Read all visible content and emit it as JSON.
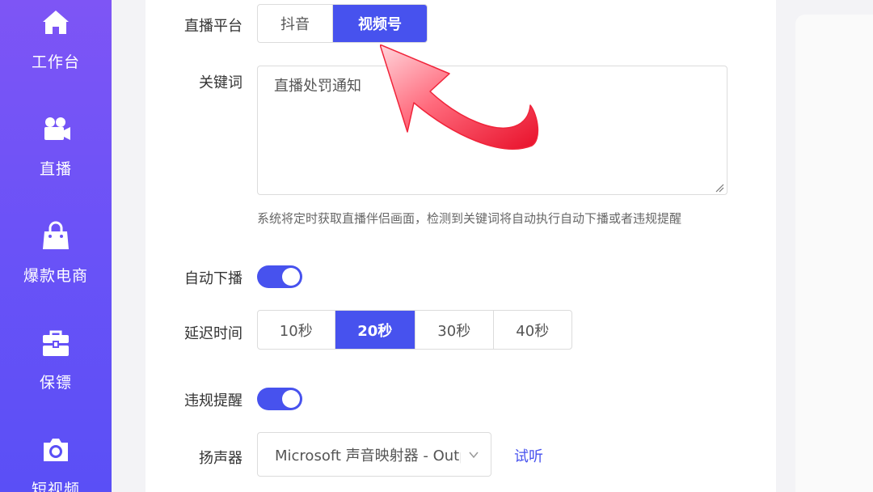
{
  "sidebar": {
    "items": [
      {
        "label": "工作台",
        "icon": "home-icon"
      },
      {
        "label": "直播",
        "icon": "video-camera-icon"
      },
      {
        "label": "爆款电商",
        "icon": "shopping-bag-icon"
      },
      {
        "label": "保镖",
        "icon": "toolbox-icon"
      },
      {
        "label": "短视频",
        "icon": "camera-icon"
      }
    ]
  },
  "form": {
    "platform": {
      "label": "直播平台",
      "options": [
        "抖音",
        "视频号"
      ],
      "selected": "视频号"
    },
    "keyword": {
      "label": "关键词",
      "value": "直播处罚通知",
      "hint": "系统将定时获取直播伴侣画面，检测到关键词将自动执行自动下播或者违规提醒"
    },
    "auto_offline": {
      "label": "自动下播",
      "enabled": true
    },
    "delay": {
      "label": "延迟时间",
      "options": [
        "10秒",
        "20秒",
        "30秒",
        "40秒"
      ],
      "selected": "20秒"
    },
    "violation_alert": {
      "label": "违规提醒",
      "enabled": true
    },
    "speaker": {
      "label": "扬声器",
      "value": "Microsoft 声音映射器 - Output",
      "test_label": "试听"
    }
  },
  "colors": {
    "accent": "#4752ee",
    "sidebar_top": "#7e55f5",
    "sidebar_bottom": "#5a4ff6",
    "annotation_arrow": "#f0243a"
  }
}
